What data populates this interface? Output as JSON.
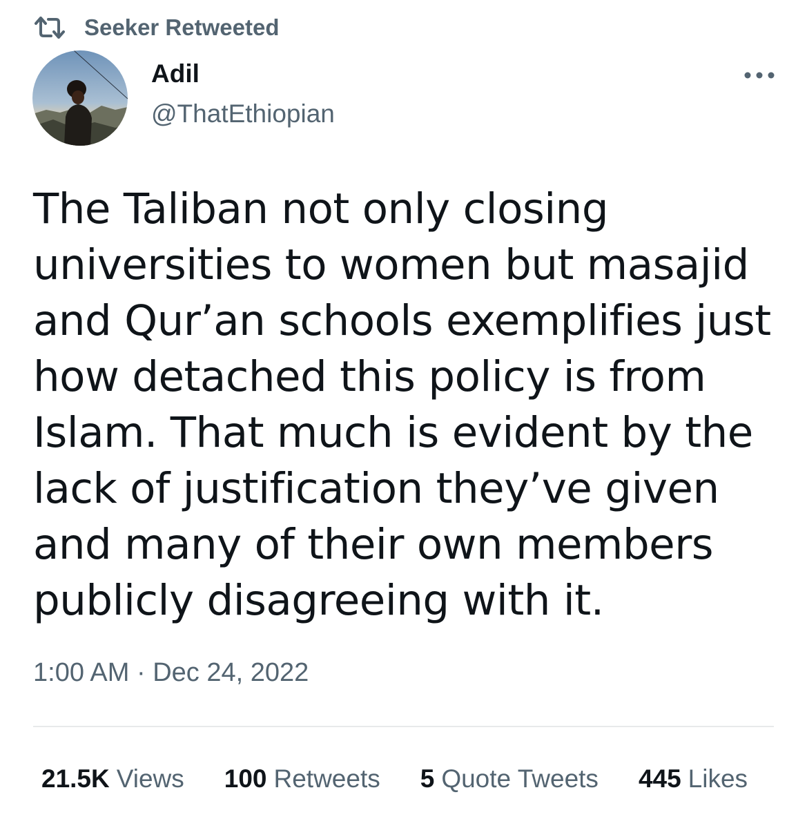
{
  "retweet_context": {
    "icon": "retweet-icon",
    "text": "Seeker Retweeted"
  },
  "author": {
    "name": "Adil",
    "handle": "@ThatEthiopian",
    "avatar": "profile-photo"
  },
  "more_icon": "more-horizontal-icon",
  "tweet": {
    "text": "The Taliban not only closing\nuniversities to women but masajid\nand Qur’an schools exemplifies just\nhow detached this policy is from\nIslam. That much is evident by the\nlack of justification they’ve given\nand many of their own members\npublicly disagreeing with it.",
    "time": "1:00 AM",
    "separator": "·",
    "date": "Dec 24, 2022"
  },
  "stats": {
    "views": {
      "value": "21.5K",
      "label": "Views"
    },
    "retweets": {
      "value": "100",
      "label": "Retweets"
    },
    "quote_tweets": {
      "value": "5",
      "label": "Quote Tweets"
    },
    "likes": {
      "value": "445",
      "label": "Likes"
    }
  },
  "colors": {
    "text_primary": "#0f1419",
    "text_secondary": "#536471",
    "divider": "#e7e9ea",
    "background": "#ffffff"
  }
}
